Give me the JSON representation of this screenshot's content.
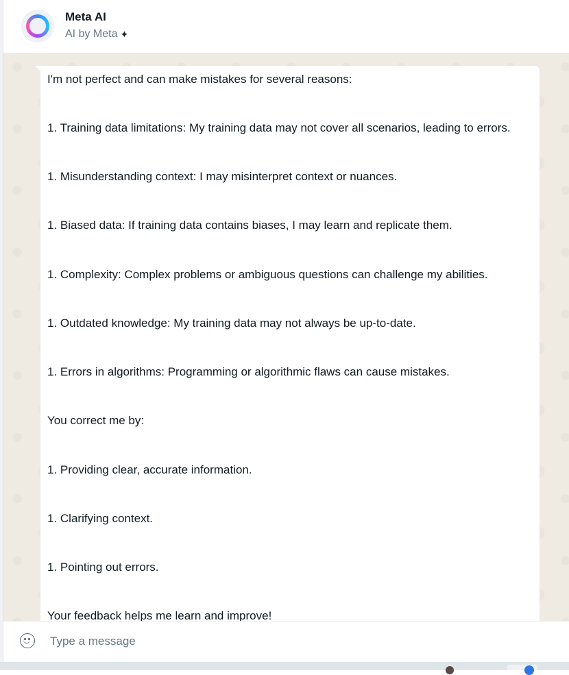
{
  "header": {
    "title": "Meta AI",
    "subtitle": "AI by Meta",
    "avatar_icon": "meta-ai-ring-icon",
    "subtitle_icon": "sparkle-icon"
  },
  "message": {
    "lines": [
      "I'm not perfect and can make mistakes for several reasons:",
      "1. Training data limitations: My training data may not cover all scenarios, leading to errors.",
      "1. Misunderstanding context: I may misinterpret context or nuances.",
      "1. Biased data: If training data contains biases, I may learn and replicate them.",
      "1. Complexity: Complex problems or ambiguous questions can challenge my abilities.",
      "1. Outdated knowledge: My training data may not always be up-to-date.",
      "1. Errors in algorithms: Programming or algorithmic flaws can cause mistakes.",
      "You correct me by:",
      "1. Providing clear, accurate information.",
      "1. Clarifying context.",
      "1. Pointing out errors.",
      "Your feedback helps me learn and improve!"
    ]
  },
  "composer": {
    "placeholder": "Type a message",
    "emoji_icon": "emoji-icon"
  },
  "colors": {
    "chat_background": "#efeae2",
    "bubble": "#ffffff",
    "secondary_text": "#667781"
  }
}
